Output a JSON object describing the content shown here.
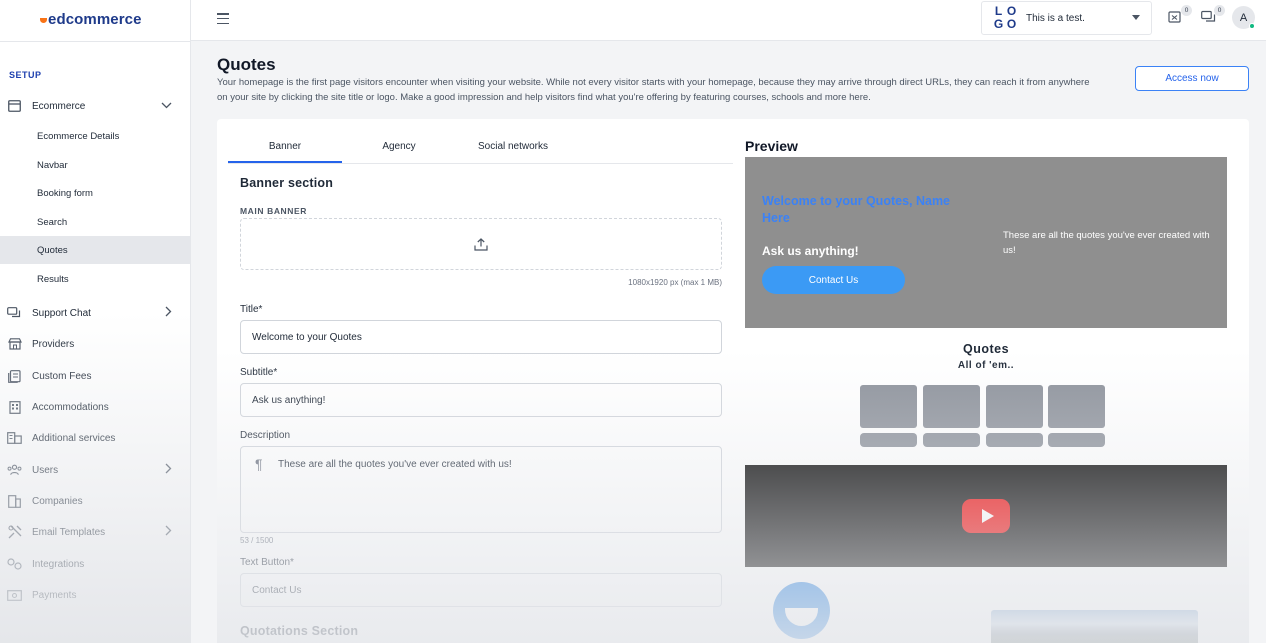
{
  "brand": {
    "name": "edcommerce"
  },
  "sidebar": {
    "section_label": "SETUP",
    "ecommerce": {
      "label": "Ecommerce",
      "children": [
        "Ecommerce Details",
        "Navbar",
        "Booking form",
        "Search",
        "Quotes",
        "Results"
      ],
      "active_child": "Quotes"
    },
    "items": [
      {
        "label": "Support Chat",
        "icon": "chat-icon",
        "has_chevron": true
      },
      {
        "label": "Providers",
        "icon": "store-icon",
        "has_chevron": false
      },
      {
        "label": "Custom Fees",
        "icon": "receipt-icon",
        "has_chevron": false
      },
      {
        "label": "Accommodations",
        "icon": "building-icon",
        "has_chevron": false
      },
      {
        "label": "Additional services",
        "icon": "services-icon",
        "has_chevron": false
      },
      {
        "label": "Users",
        "icon": "users-icon",
        "has_chevron": true
      },
      {
        "label": "Companies",
        "icon": "companies-icon",
        "has_chevron": false
      },
      {
        "label": "Email Templates",
        "icon": "email-template-icon",
        "has_chevron": true
      },
      {
        "label": "Integrations",
        "icon": "integrations-icon",
        "has_chevron": false
      },
      {
        "label": "Payments",
        "icon": "payments-icon",
        "has_chevron": false
      }
    ]
  },
  "topbar": {
    "site_logo_letters": [
      "L",
      "O",
      "G",
      "O"
    ],
    "site_name": "This is a test.",
    "notifications_count": "0",
    "messages_count": "0",
    "avatar_initial": "A"
  },
  "page": {
    "title": "Quotes",
    "description": "Your homepage is the first page visitors encounter when visiting your website. While not every visitor starts with your homepage, because they may arrive through direct URLs, they can reach it from anywhere on your site by clicking the site title or logo. Make a good impression and help visitors find what you're offering by featuring courses, schools and more here.",
    "access_button": "Access now"
  },
  "tabs": [
    "Banner",
    "Agency",
    "Social networks"
  ],
  "active_tab": "Banner",
  "form": {
    "banner_section": "Banner section",
    "main_banner_label": "MAIN BANNER",
    "banner_hint": "1080x1920 px (max 1 MB)",
    "title_label": "Title*",
    "title_value": "Welcome to your Quotes",
    "subtitle_label": "Subtitle*",
    "subtitle_value": "Ask us anything!",
    "description_label": "Description",
    "description_value": "These are all the quotes you've ever created with us!",
    "description_counter": "53 / 1500",
    "text_button_label": "Text Button*",
    "text_button_value": "Contact Us",
    "quotations_section": "Quotations Section"
  },
  "preview": {
    "label": "Preview",
    "hero_title": "Welcome to your Quotes, Name Here",
    "hero_subtitle": "Ask us anything!",
    "hero_button": "Contact Us",
    "hero_description": "These are all the quotes you've ever created with us!",
    "quotes_title": "Quotes",
    "quotes_subtitle": "All of 'em..",
    "quote_placeholder_count": 4
  },
  "colors": {
    "accent": "#2563eb",
    "brand_navy": "#1e3a8a",
    "brand_orange": "#f97316",
    "hero_bg": "#8f8f8f",
    "hero_button": "#3b9af5",
    "youtube_red": "#ee0000"
  }
}
